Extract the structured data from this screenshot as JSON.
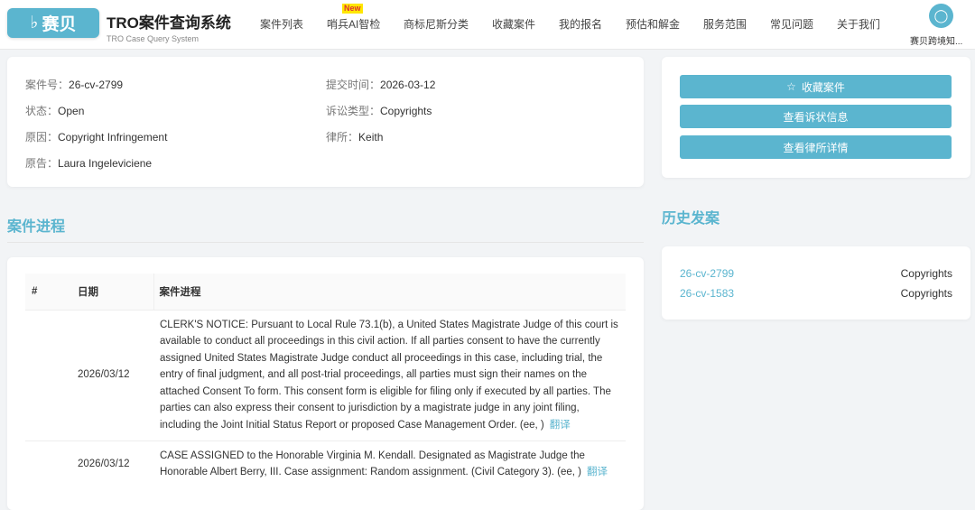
{
  "header": {
    "logo_text": "赛贝",
    "title": "TRO案件查询系统",
    "subtitle": "TRO Case Query System",
    "badge": "New",
    "nav": [
      "案件列表",
      "哨兵AI智检",
      "商标尼斯分类",
      "收藏案件",
      "我的报名",
      "预估和解金",
      "服务范围",
      "常见问题",
      "关于我们"
    ],
    "user": "赛贝跨境知..."
  },
  "case": {
    "number_label": "案件号：",
    "number": "26-cv-2799",
    "submit_label": "提交时间：",
    "submit": "2026-03-12",
    "status_label": "状态：",
    "status": "Open",
    "type_label": "诉讼类型：",
    "type": "Copyrights",
    "cause_label": "原因：",
    "cause": "Copyright Infringement",
    "firm_label": "律所：",
    "firm": "Keith",
    "plaintiff_label": "原告：",
    "plaintiff": "Laura Ingeleviciene"
  },
  "actions": {
    "favorite": "收藏案件",
    "complaint": "查看诉状信息",
    "firm": "查看律所详情"
  },
  "progress": {
    "title": "案件进程",
    "headers": [
      "#",
      "日期",
      "案件进程"
    ],
    "translate": "翻译",
    "rows": [
      {
        "num": "",
        "date": "2026/03/12",
        "text": "CLERK'S NOTICE: Pursuant to Local Rule 73.1(b), a United States Magistrate Judge of this court is available to conduct all proceedings in this civil action. If all parties consent to have the currently assigned United States Magistrate Judge conduct all proceedings in this case, including trial, the entry of final judgment, and all post-trial proceedings, all parties must sign their names on the attached Consent To form. This consent form is eligible for filing only if executed by all parties. The parties can also express their consent to jurisdiction by a magistrate judge in any joint filing, including the Joint Initial Status Report or proposed Case Management Order. (ee, )"
      },
      {
        "num": "",
        "date": "2026/03/12",
        "text": "CASE ASSIGNED to the Honorable Virginia M. Kendall. Designated as Magistrate Judge the Honorable Albert Berry, III. Case assignment: Random assignment. (Civil Category 3). (ee, )"
      }
    ]
  },
  "history": {
    "title": "历史发案",
    "items": [
      {
        "case": "26-cv-2799",
        "type": "Copyrights"
      },
      {
        "case": "26-cv-1583",
        "type": "Copyrights"
      }
    ]
  }
}
